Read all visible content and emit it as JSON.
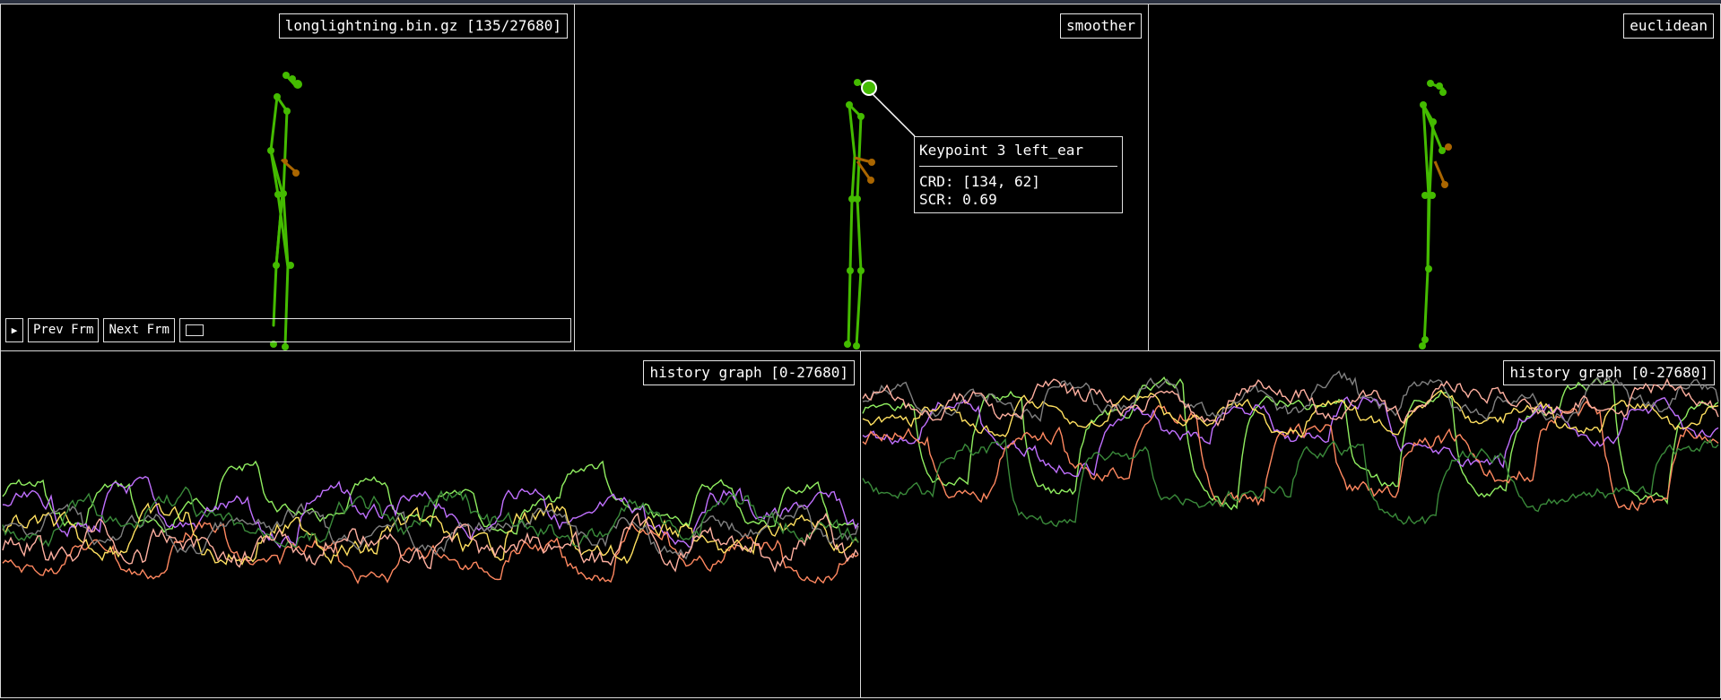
{
  "views": {
    "original_label": "longlightning.bin.gz [135/27680]",
    "smoother_label": "smoother",
    "euclidean_label": "euclidean"
  },
  "controls": {
    "play_icon": "▶",
    "prev_label": "Prev Frm",
    "next_label": "Next Frm"
  },
  "tooltip": {
    "title": "Keypoint 3 left_ear",
    "crd": "CRD: [134, 62]",
    "scr": "SCR: 0.69"
  },
  "graphs": {
    "left_label": "history graph [0-27680]",
    "right_label": "history graph [0-27680]"
  },
  "colors": {
    "skeleton_green": "#44bb00",
    "skeleton_orange": "#aa6600",
    "series": [
      "#90ee60",
      "#c070ff",
      "#ff8860",
      "#ffe060",
      "#808080",
      "#3a8a3a",
      "#ffb0a0"
    ]
  }
}
